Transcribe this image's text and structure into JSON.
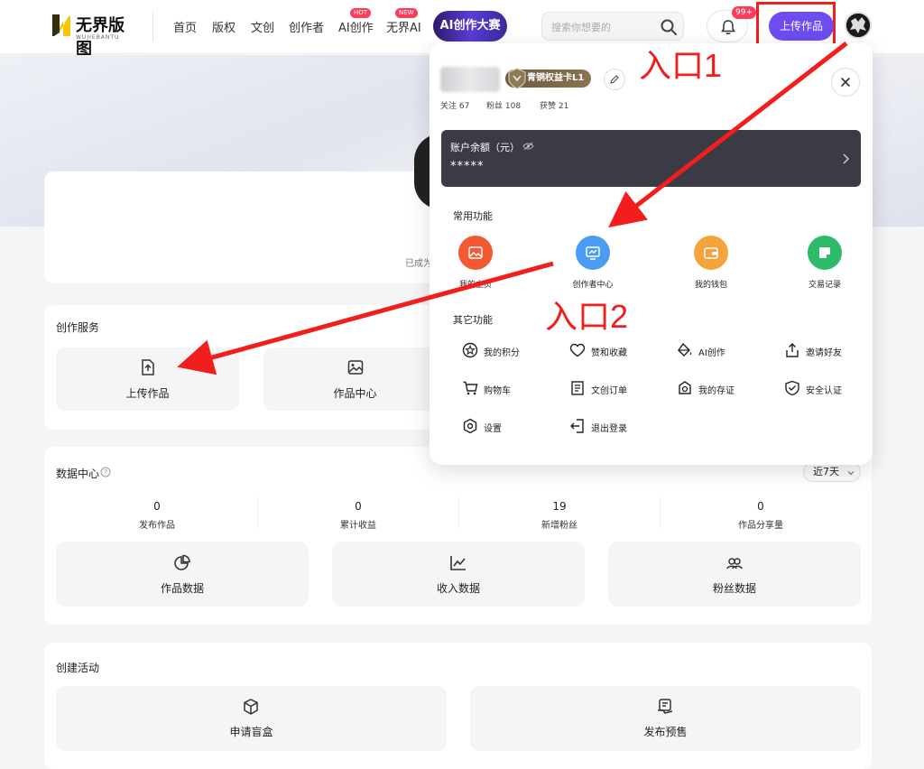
{
  "header": {
    "logo_text": "无界版图",
    "logo_sub": "WUJIEBANTU",
    "nav": [
      {
        "label": "首页"
      },
      {
        "label": "版权"
      },
      {
        "label": "文创"
      },
      {
        "label": "创作者"
      },
      {
        "label": "AI创作",
        "tag": "HOT"
      },
      {
        "label": "无界AI",
        "tag": "NEW"
      }
    ],
    "contest_label": "AI创作大赛",
    "search_placeholder": "搜索你想要的",
    "notification_count": "99+",
    "upload_label": "上传作品"
  },
  "background": {
    "hint_text": "已成为"
  },
  "creation_service": {
    "title": "创作服务",
    "tiles": [
      {
        "label": "上传作品",
        "icon": "upload-icon"
      },
      {
        "label": "作品中心",
        "icon": "image-icon"
      }
    ]
  },
  "data_center": {
    "title": "数据中心",
    "period": "近7天",
    "stats": [
      {
        "value": "0",
        "label": "发布作品"
      },
      {
        "value": "0",
        "label": "累计收益"
      },
      {
        "value": "19",
        "label": "新增粉丝"
      },
      {
        "value": "0",
        "label": "作品分享量"
      }
    ],
    "tiles": [
      {
        "label": "作品数据",
        "icon": "pie-chart-icon"
      },
      {
        "label": "收入数据",
        "icon": "line-chart-icon"
      },
      {
        "label": "粉丝数据",
        "icon": "users-icon"
      }
    ]
  },
  "activities": {
    "title": "创建活动",
    "tiles": [
      {
        "label": "申请盲盒",
        "icon": "box-icon"
      },
      {
        "label": "发布预售",
        "icon": "presale-icon"
      }
    ]
  },
  "popover": {
    "level": "青铜权益卡L1",
    "follow": "关注 67",
    "fans": "粉丝 108",
    "likes": "获赞 21",
    "balance_label": "账户余额（元）",
    "balance_value": "*****",
    "common_title": "常用功能",
    "common": [
      {
        "label": "我的主页",
        "color": "#f45a32"
      },
      {
        "label": "创作者中心",
        "color": "#4a9cf5"
      },
      {
        "label": "我的钱包",
        "color": "#f5a33c"
      },
      {
        "label": "交易记录",
        "color": "#2dbb6a"
      }
    ],
    "other_title": "其它功能",
    "other": [
      {
        "label": "我的积分"
      },
      {
        "label": "赞和收藏"
      },
      {
        "label": "AI创作"
      },
      {
        "label": "邀请好友"
      },
      {
        "label": "购物车"
      },
      {
        "label": "文创订单"
      },
      {
        "label": "我的存证"
      },
      {
        "label": "安全认证"
      },
      {
        "label": "设置"
      },
      {
        "label": "退出登录"
      }
    ]
  },
  "annotations": {
    "entry1": "入口1",
    "entry2": "入口2"
  }
}
